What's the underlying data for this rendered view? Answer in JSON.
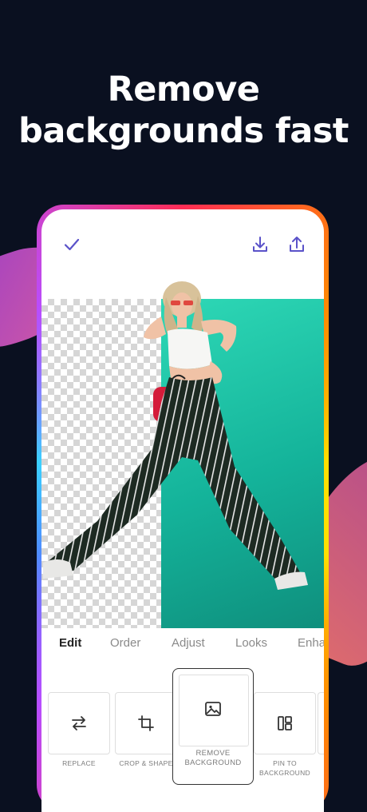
{
  "headline": {
    "line1": "Remove",
    "line2": "backgrounds fast"
  },
  "topbar": {
    "done_icon": "checkmark-icon",
    "download_icon": "download-icon",
    "share_icon": "share-icon"
  },
  "tabs": [
    {
      "label": "Edit",
      "active": true
    },
    {
      "label": "Order",
      "active": false
    },
    {
      "label": "Adjust",
      "active": false
    },
    {
      "label": "Looks",
      "active": false
    },
    {
      "label": "Enha",
      "active": false
    }
  ],
  "tools": [
    {
      "label": "REPLACE",
      "icon": "swap-arrows-icon"
    },
    {
      "label": "CROP & SHAPE",
      "icon": "crop-icon"
    },
    {
      "label_line1": "REMOVE",
      "label_line2": "BACKGROUND",
      "icon": "image-icon",
      "selected": true
    },
    {
      "label_line1": "PIN TO",
      "label_line2": "BACKGROUND",
      "icon": "layout-icon"
    }
  ],
  "colors": {
    "accent": "#5a52c9",
    "background": "#0a1020",
    "teal": "#1cc3a5"
  }
}
